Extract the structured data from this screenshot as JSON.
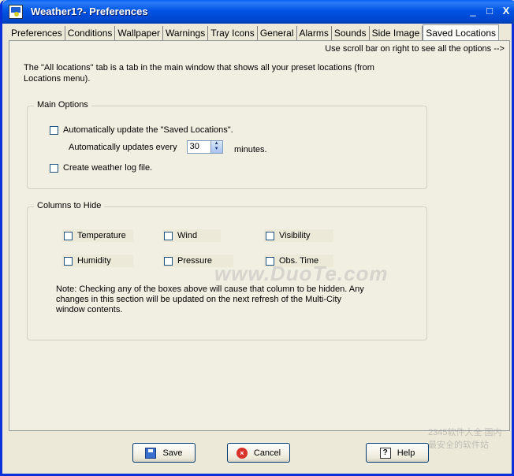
{
  "window": {
    "title": "Weather1?- Preferences"
  },
  "titlebar": {
    "minimize": "_",
    "maximize": "□",
    "close": "X"
  },
  "tabs": [
    "Preferences",
    "Conditions",
    "Wallpaper",
    "Warnings",
    "Tray Icons",
    "General",
    "Alarms",
    "Sounds",
    "Side Image",
    "Saved Locations"
  ],
  "active_tab": "Saved Locations",
  "scroll_hint": "Use scroll bar on right to see all the options -->",
  "intro": "The \"All locations\" tab is a tab in the main window that shows all your preset locations (from Locations menu).",
  "main_options": {
    "title": "Main Options",
    "auto_update_label": "Automatically update the \"Saved Locations\".",
    "auto_update_checked": false,
    "interval_label": "Automatically updates every",
    "interval_value": "30",
    "interval_unit": "minutes.",
    "log_label": "Create weather log file.",
    "log_checked": false
  },
  "columns_to_hide": {
    "title": "Columns to Hide",
    "items": [
      {
        "label": "Temperature",
        "checked": false
      },
      {
        "label": "Wind",
        "checked": false
      },
      {
        "label": "Visibility",
        "checked": false
      },
      {
        "label": "Humidity",
        "checked": false
      },
      {
        "label": "Pressure",
        "checked": false
      },
      {
        "label": "Obs. Time",
        "checked": false
      }
    ],
    "note": "Note: Checking any of the boxes above will cause that column to be hidden. Any changes in this section will be updated on the next refresh of the Multi-City window contents."
  },
  "buttons": {
    "save": "Save",
    "cancel": "Cancel",
    "help": "Help"
  },
  "watermark": "www.DuoTe.com",
  "corner_watermark": "2345软件大全 国内最安全的软件站"
}
